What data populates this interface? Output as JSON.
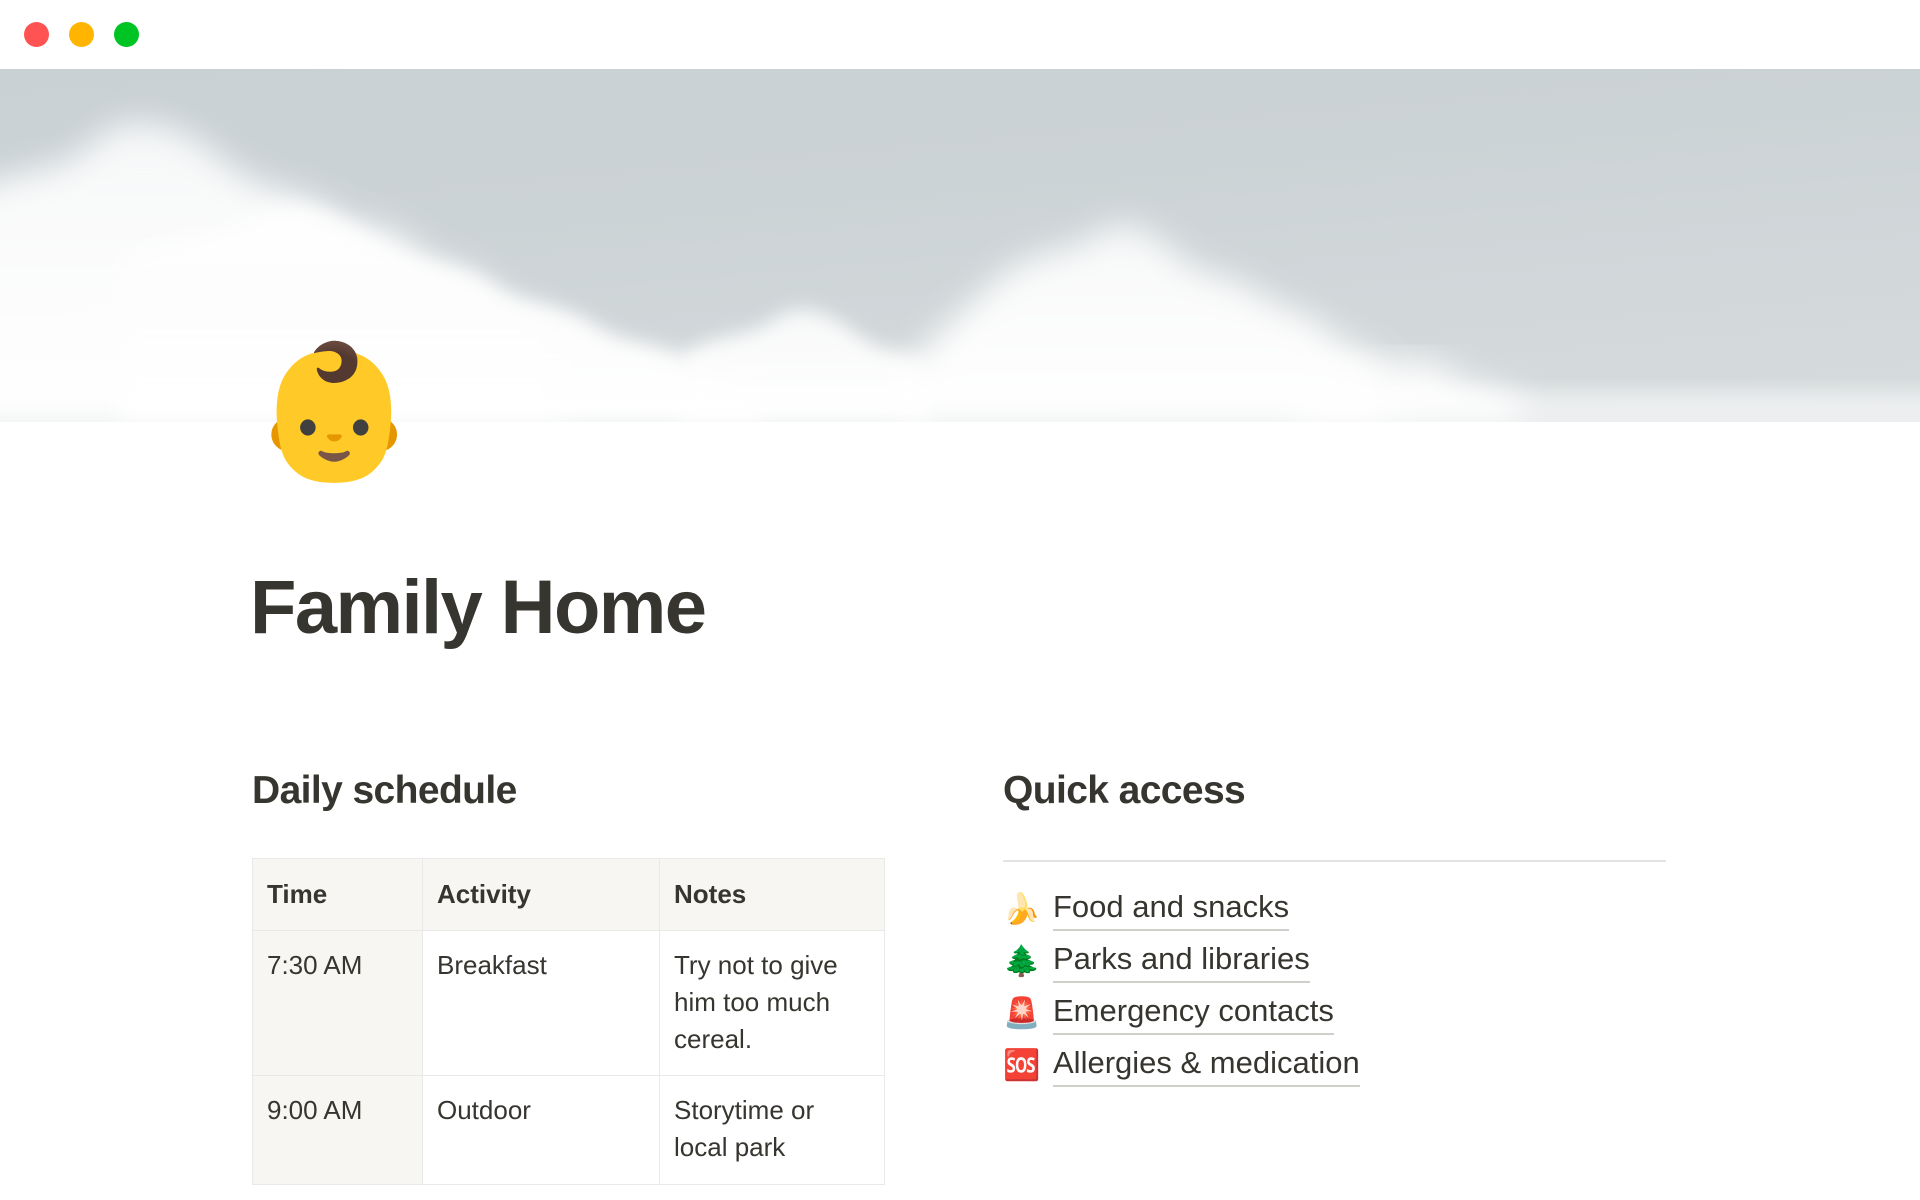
{
  "window": {
    "traffic_lights": [
      {
        "name": "close",
        "color": "#ff5252"
      },
      {
        "name": "minimize",
        "color": "#ffb400"
      },
      {
        "name": "maximize",
        "color": "#00c423"
      }
    ]
  },
  "cover": {
    "description": "clouds-and-sky-cover-photo",
    "sky_color": "#ccd3d6",
    "cloud_color": "#f7f8f8"
  },
  "page": {
    "icon": "👶",
    "icon_name": "baby-emoji",
    "title": "Family Home",
    "title_color": "#37352f"
  },
  "daily_schedule": {
    "heading": "Daily schedule",
    "columns": [
      "Time",
      "Activity",
      "Notes"
    ],
    "rows": [
      {
        "time": "7:30 AM",
        "activity": "Breakfast",
        "notes": "Try not to give him too much cereal."
      },
      {
        "time": "9:00 AM",
        "activity": "Outdoor",
        "notes": "Storytime or local park"
      }
    ]
  },
  "quick_access": {
    "heading": "Quick access",
    "items": [
      {
        "emoji": "🍌",
        "icon_name": "banana-icon",
        "label": "Food and snacks"
      },
      {
        "emoji": "🌲",
        "icon_name": "evergreen-tree-icon",
        "label": "Parks and libraries"
      },
      {
        "emoji": "🚨",
        "icon_name": "police-light-icon",
        "label": "Emergency contacts"
      },
      {
        "emoji": "🆘",
        "icon_name": "sos-icon",
        "label": "Allergies & medication"
      }
    ]
  }
}
